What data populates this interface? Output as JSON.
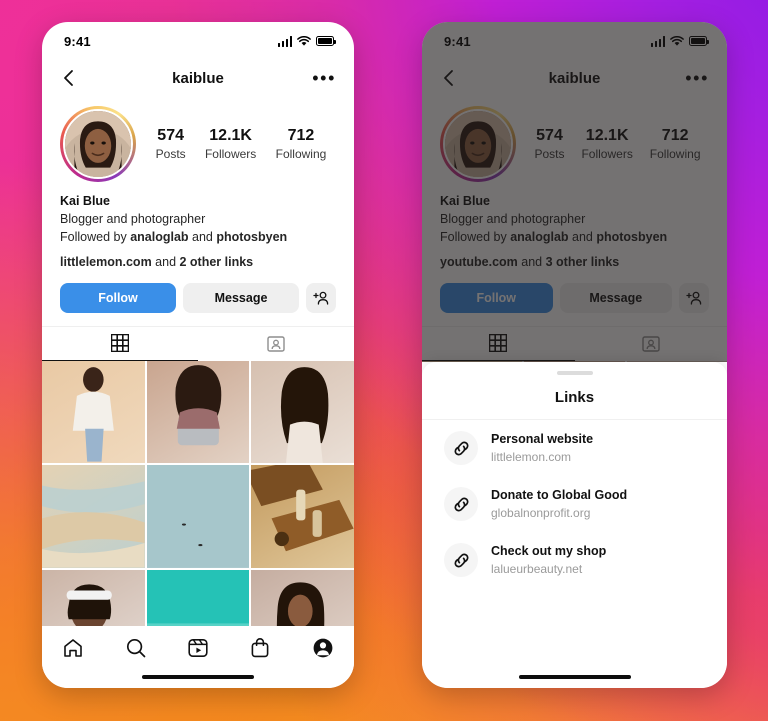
{
  "background": {
    "gradient_colors": [
      "#e8338f",
      "#ef4b40",
      "#f7a827",
      "#8b1ae8",
      "#e82b6a"
    ]
  },
  "theme": {
    "follow_blue": "#3a8fe8",
    "chip_gray": "#efefef",
    "muted_text": "#9a9a9a"
  },
  "phone_left": {
    "status": {
      "time": "9:41",
      "signal_icon": "cellular-bars-icon",
      "wifi_icon": "wifi-icon",
      "battery_icon": "battery-icon"
    },
    "nav": {
      "back_icon": "chevron-left-icon",
      "title": "kaiblue",
      "more_icon": "ellipsis-icon"
    },
    "avatar": {
      "name": "avatar",
      "alt": "Kai Blue profile photo"
    },
    "stats": [
      {
        "value": "574",
        "label": "Posts"
      },
      {
        "value": "12.1K",
        "label": "Followers"
      },
      {
        "value": "712",
        "label": "Following"
      }
    ],
    "bio": {
      "name": "Kai Blue",
      "description": "Blogger and photographer",
      "followed_prefix": "Followed by ",
      "followed_user1": "analoglab",
      "followed_joiner": " and ",
      "followed_user2": "photosbyen",
      "link_primary": "littlelemon.com",
      "link_joiner": " and ",
      "link_other": "2 other links"
    },
    "actions": {
      "follow": "Follow",
      "message": "Message",
      "add_user_icon": "add-person-icon"
    },
    "tabs": [
      {
        "icon": "grid-icon",
        "active": true
      },
      {
        "icon": "tagged-person-icon",
        "active": false
      }
    ],
    "bottom_nav": [
      {
        "icon": "home-icon"
      },
      {
        "icon": "search-icon"
      },
      {
        "icon": "reels-icon"
      },
      {
        "icon": "shop-icon"
      },
      {
        "icon": "profile-avatar-icon"
      }
    ]
  },
  "phone_right": {
    "status": {
      "time": "9:41",
      "signal_icon": "cellular-bars-icon",
      "wifi_icon": "wifi-icon",
      "battery_icon": "battery-icon"
    },
    "nav": {
      "back_icon": "chevron-left-icon",
      "title": "kaiblue",
      "more_icon": "ellipsis-icon"
    },
    "stats": [
      {
        "value": "574",
        "label": "Posts"
      },
      {
        "value": "12.1K",
        "label": "Followers"
      },
      {
        "value": "712",
        "label": "Following"
      }
    ],
    "bio": {
      "name": "Kai Blue",
      "description": "Blogger and photographer",
      "followed_prefix": "Followed by ",
      "followed_user1": "analoglab",
      "followed_joiner": " and ",
      "followed_user2": "photosbyen",
      "link_primary": "youtube.com",
      "link_joiner": " and ",
      "link_other": "3 other links"
    },
    "actions": {
      "follow": "Follow",
      "message": "Message",
      "add_user_icon": "add-person-icon"
    },
    "sheet": {
      "title": "Links",
      "handle_icon": "drag-handle",
      "links": [
        {
          "title": "Personal website",
          "url": "littlelemon.com",
          "icon": "chain-link-icon"
        },
        {
          "title": "Donate to Global Good",
          "url": "globalnonprofit.org",
          "icon": "chain-link-icon"
        },
        {
          "title": "Check out my shop",
          "url": "lalueurbeauty.net",
          "icon": "chain-link-icon"
        }
      ]
    }
  },
  "grid_photos": [
    {
      "alt": "woman in white cardigan and ripped jeans",
      "c1": "#e9c9a4",
      "c2": "#f0d9bd"
    },
    {
      "alt": "woman cooking with steel pot",
      "c1": "#c9a58f",
      "c2": "#e3d2c5"
    },
    {
      "alt": "woman in white tank top portrait",
      "c1": "#d6c0b0",
      "c2": "#eadfd6"
    },
    {
      "alt": "abstract sand and water aerial",
      "c1": "#e4d2b4",
      "c2": "#bcd0cf"
    },
    {
      "alt": "aerial ocean with boats",
      "c1": "#9fc2c6",
      "c2": "#b9d3d6"
    },
    {
      "alt": "skincare bottles on wood",
      "c1": "#c39a5e",
      "c2": "#e0c79a"
    },
    {
      "alt": "woman with headband smiling",
      "c1": "#cbb4a6",
      "c2": "#e6dcd6"
    },
    {
      "alt": "turquoise sea and rocky coast",
      "c1": "#2fc6bb",
      "c2": "#7fd9cf"
    },
    {
      "alt": "woman with long dark hair portrait",
      "c1": "#c5ada0",
      "c2": "#e4d7ce"
    }
  ]
}
